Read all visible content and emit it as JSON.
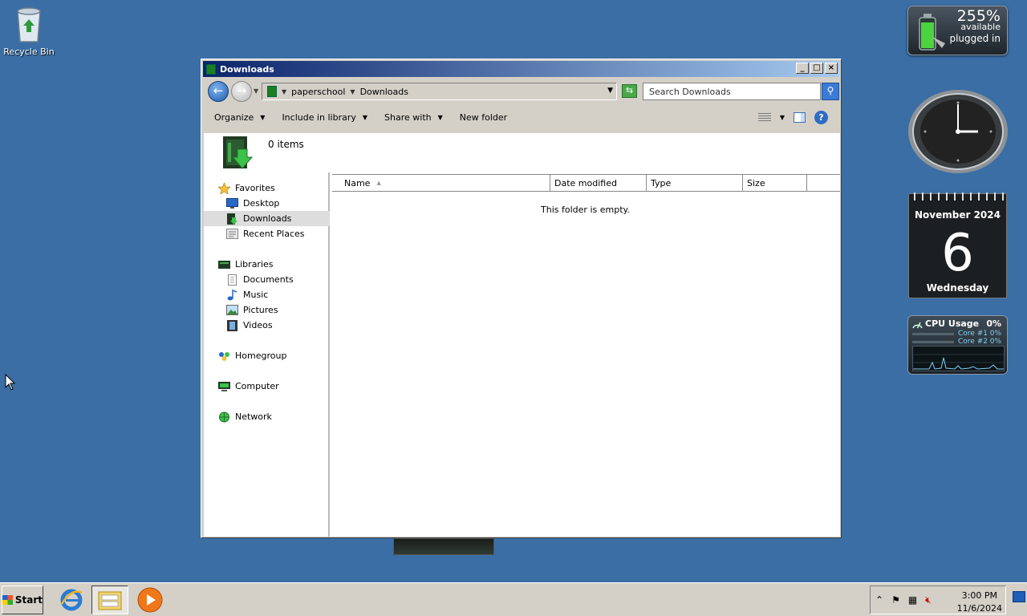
{
  "desktop": {
    "recycle_bin_label": "Recycle Bin"
  },
  "gadgets": {
    "battery": {
      "percent": "255%",
      "status": "available",
      "power": "plugged in"
    },
    "calendar": {
      "month_year": "November 2024",
      "day": "6",
      "weekday": "Wednesday"
    },
    "cpu": {
      "title": "CPU Usage",
      "total": "0%",
      "core1_label": "Core #1",
      "core1_value": "0%",
      "core2_label": "Core #2",
      "core2_value": "0%"
    }
  },
  "window": {
    "title": "Downloads",
    "address": {
      "crumb1": "paperschool",
      "crumb2": "Downloads"
    },
    "search_placeholder": "Search Downloads",
    "toolbar": {
      "organize": "Organize",
      "include_in_library": "Include in library",
      "share_with": "Share with",
      "new_folder": "New folder"
    },
    "details": {
      "item_count": "0 items"
    },
    "nav": {
      "favorites": "Favorites",
      "desktop": "Desktop",
      "downloads": "Downloads",
      "recent_places": "Recent Places",
      "libraries": "Libraries",
      "documents": "Documents",
      "music": "Music",
      "pictures": "Pictures",
      "videos": "Videos",
      "homegroup": "Homegroup",
      "computer": "Computer",
      "network": "Network"
    },
    "columns": {
      "name": "Name",
      "date_modified": "Date modified",
      "type": "Type",
      "size": "Size"
    },
    "empty_message": "This folder is empty."
  },
  "taskbar": {
    "start_label": "Start",
    "time": "3:00 PM",
    "date": "11/6/2024"
  }
}
